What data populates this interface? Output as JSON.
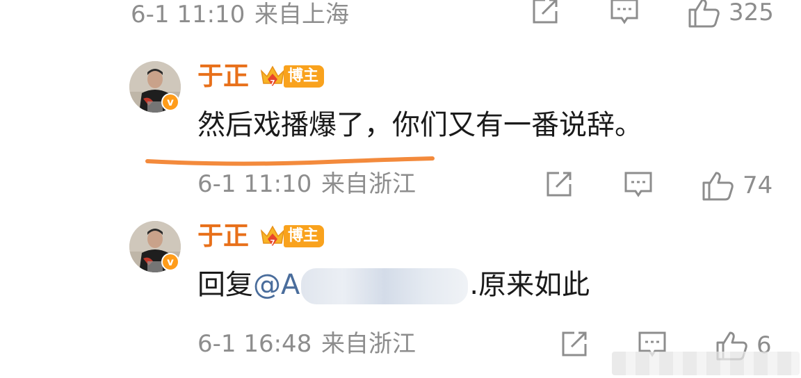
{
  "top_meta": {
    "timestamp": "6-1 11:10",
    "location": "来自上海",
    "like_count": "325"
  },
  "comments": [
    {
      "author": "于正",
      "role_badge": "博主",
      "body": "然后戏播爆了，你们又有一番说辞。",
      "timestamp": "6-1 11:10",
      "location": "来自浙江",
      "like_count": "74"
    },
    {
      "author": "于正",
      "role_badge": "博主",
      "reply_prefix": "回复",
      "mention": "@A",
      "mention_tail": ".原来如此",
      "timestamp": "6-1 16:48",
      "location": "来自浙江",
      "like_count": "6"
    }
  ],
  "colors": {
    "author": "#e8701a",
    "meta": "#8d8d8d",
    "mention": "#4a6d9c",
    "underline": "#f38a3c",
    "verified_badge": "#ff9c1a"
  },
  "icons": [
    "share-icon",
    "comment-icon",
    "thumbs-up-icon",
    "crown-icon",
    "verified-badge-icon"
  ]
}
